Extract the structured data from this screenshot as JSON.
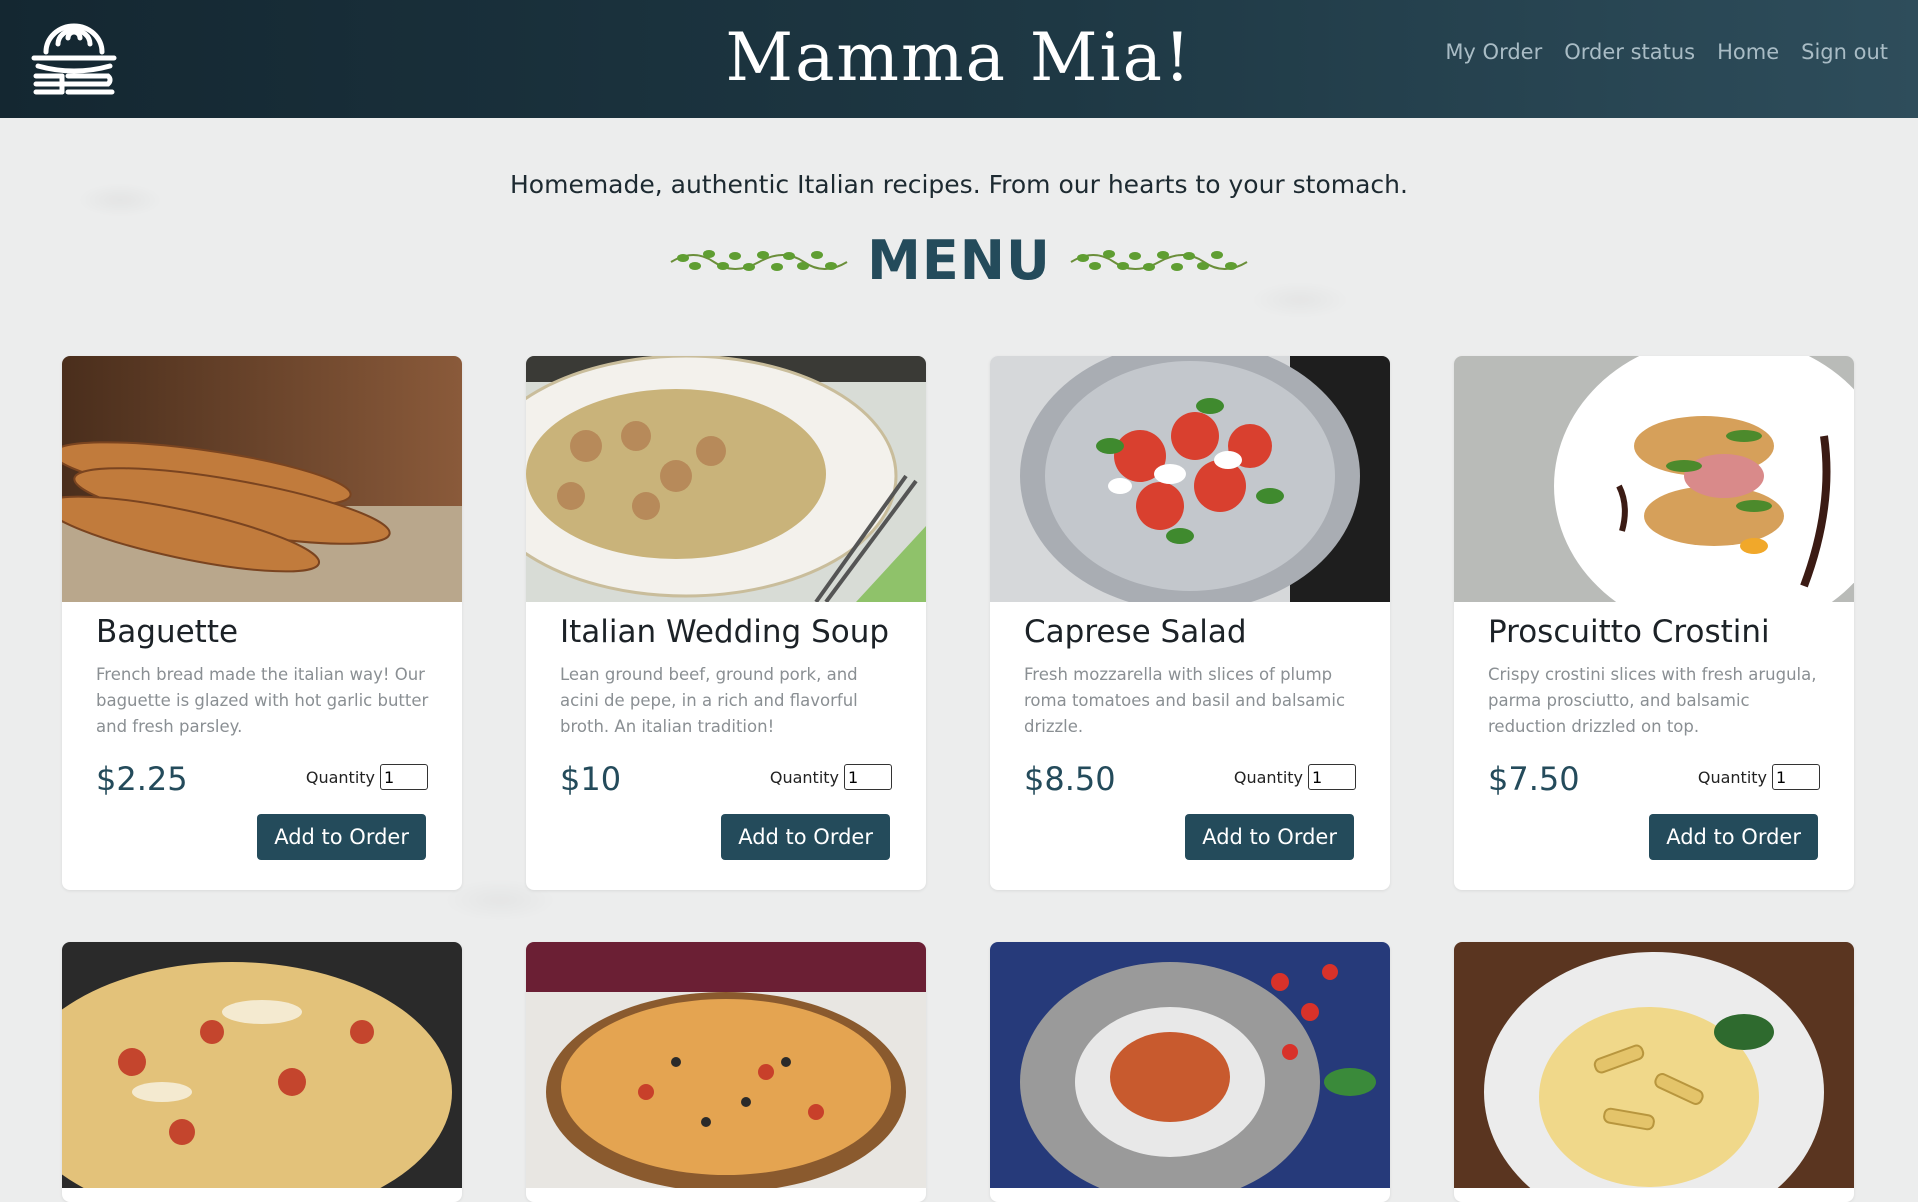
{
  "header": {
    "brand": "Mamma Mia!",
    "logo_icon": "plate-fork-knife-icon",
    "nav": [
      "My Order",
      "Order status",
      "Home",
      "Sign out"
    ]
  },
  "intro": {
    "tagline": "Homemade, authentic Italian recipes. From our hearts to your stomach.",
    "menu_title": "MENU",
    "decoration_icon": "vine-icon"
  },
  "menu_items": [
    {
      "name": "Baguette",
      "description": "French bread made the italian way! Our baguette is glazed with hot garlic butter and fresh parsley.",
      "price": "$2.25",
      "quantity_label": "Quantity",
      "quantity": "1",
      "button": "Add to Order",
      "image_icon": "baguette-photo"
    },
    {
      "name": "Italian Wedding Soup",
      "description": "Lean ground beef, ground pork, and acini de pepe, in a rich and flavorful broth. An italian tradition!",
      "price": "$10",
      "quantity_label": "Quantity",
      "quantity": "1",
      "button": "Add to Order",
      "image_icon": "soup-photo"
    },
    {
      "name": "Caprese Salad",
      "description": "Fresh mozzarella with slices of plump roma tomatoes and basil and balsamic drizzle.",
      "price": "$8.50",
      "quantity_label": "Quantity",
      "quantity": "1",
      "button": "Add to Order",
      "image_icon": "salad-photo"
    },
    {
      "name": "Proscuitto Crostini",
      "description": "Crispy crostini slices with fresh arugula, parma prosciutto, and balsamic reduction drizzled on top.",
      "price": "$7.50",
      "quantity_label": "Quantity",
      "quantity": "1",
      "button": "Add to Order",
      "image_icon": "crostini-photo"
    }
  ],
  "menu_items_row2": [
    {
      "image_icon": "pizza-slice-photo"
    },
    {
      "image_icon": "pizza-photo"
    },
    {
      "image_icon": "spaghetti-photo"
    },
    {
      "image_icon": "penne-photo"
    }
  ],
  "colors": {
    "header_dark": "#142731",
    "accent": "#244b5b",
    "background": "#eceded",
    "nav_text": "#a9bcc5"
  }
}
